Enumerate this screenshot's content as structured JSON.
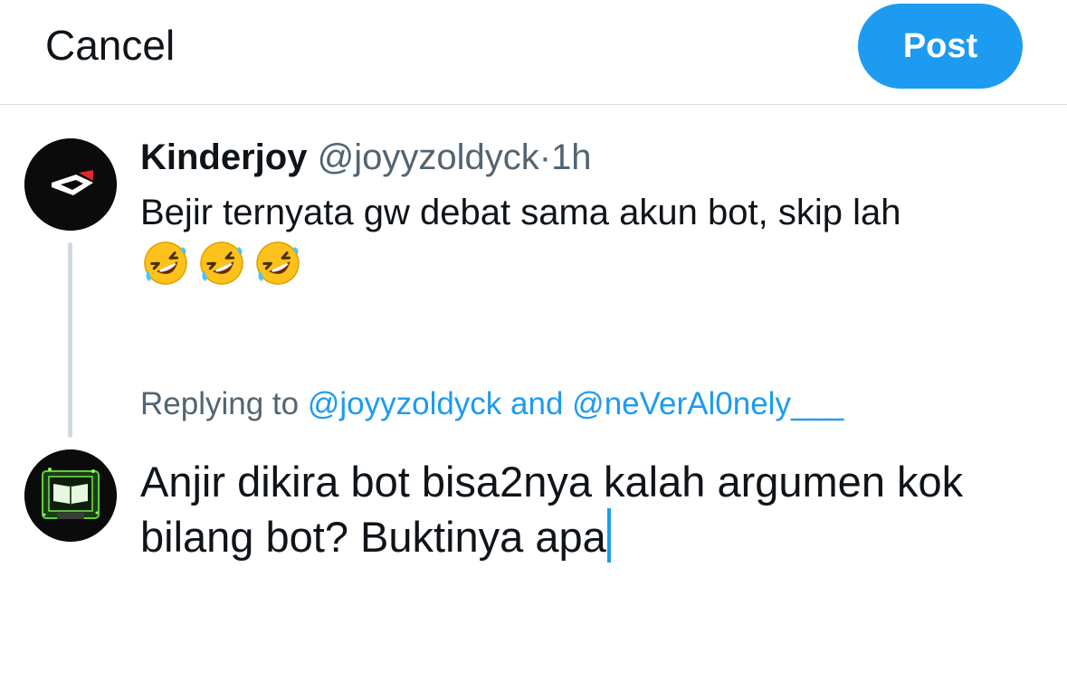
{
  "header": {
    "cancel_label": "Cancel",
    "post_label": "Post"
  },
  "original_tweet": {
    "display_name": "Kinderjoy",
    "handle": "@joyyzoldyck",
    "separator": "·",
    "time": "1h",
    "text": "Bejir ternyata gw debat sama akun bot, skip lah",
    "emojis": [
      "rolling-on-floor-laughing",
      "rolling-on-floor-laughing",
      "rolling-on-floor-laughing"
    ]
  },
  "reply_context": {
    "prefix": "Replying to ",
    "mention_1": "@joyyzoldyck",
    "joiner": " and ",
    "mention_2": "@neVerAl0nely___"
  },
  "compose": {
    "text": "Anjir dikira bot bisa2nya kalah argumen kok bilang bot? Buktinya apa"
  },
  "colors": {
    "accent": "#1d9bf0",
    "text_primary": "#0f1419",
    "text_secondary": "#536471",
    "thread_line": "#cfd9de",
    "divider": "#d9dde1"
  }
}
